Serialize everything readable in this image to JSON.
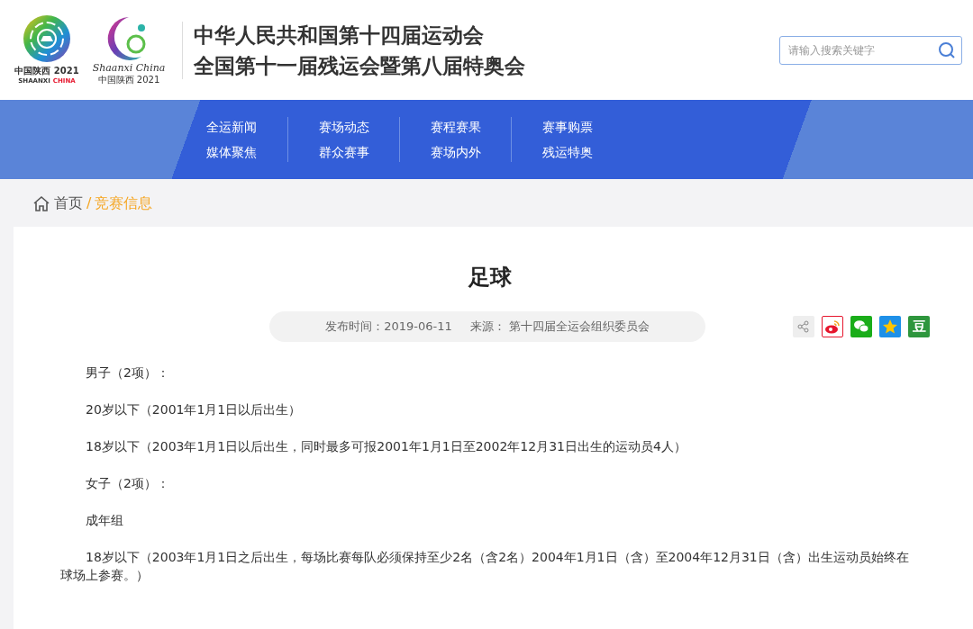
{
  "logos": [
    {
      "kind": "emblem",
      "caption_top": "中国陕西 2021",
      "caption_a": "SHAANXI",
      "caption_b": "CHINA"
    },
    {
      "kind": "mascot",
      "caption_top": "Shaanxi China",
      "caption_a": "中国陕西 2021"
    }
  ],
  "site_title": [
    "中华人民共和国第十四届运动会",
    "全国第十一届残运会暨第八届特奥会"
  ],
  "search": {
    "placeholder": "请输入搜索关键字"
  },
  "nav": [
    [
      "全运新闻",
      "媒体聚焦"
    ],
    [
      "赛场动态",
      "群众赛事"
    ],
    [
      "赛程赛果",
      "赛场内外"
    ],
    [
      "赛事购票",
      "残运特奥"
    ]
  ],
  "breadcrumb": [
    {
      "label": "首页",
      "selected": false
    },
    {
      "label": "竞赛信息",
      "selected": true
    }
  ],
  "breadcrumb_separator": "/",
  "article": {
    "title": "足球",
    "published_label": "发布时间：",
    "published": "2019-06-11",
    "source_label": "来源：",
    "source": "第十四届全运会组织委员会",
    "share": [
      {
        "kind": "share"
      },
      {
        "kind": "weibo"
      },
      {
        "kind": "wechat"
      },
      {
        "kind": "qzone"
      },
      {
        "kind": "douban",
        "glyph": "豆"
      }
    ],
    "paragraphs": [
      "男子（2项）：",
      "20岁以下（2001年1月1日以后出生）",
      "18岁以下（2003年1月1日以后出生，同时最多可报2001年1月1日至2002年12月31日出生的运动员4人）",
      "女子（2项）：",
      "成年组",
      "18岁以下（2003年1月1日之后出生，每场比赛每队必须保持至少2名（含2名）2004年1月1日（含）至2004年12月31日（含）出生运动员始终在球场上参赛。）"
    ]
  }
}
